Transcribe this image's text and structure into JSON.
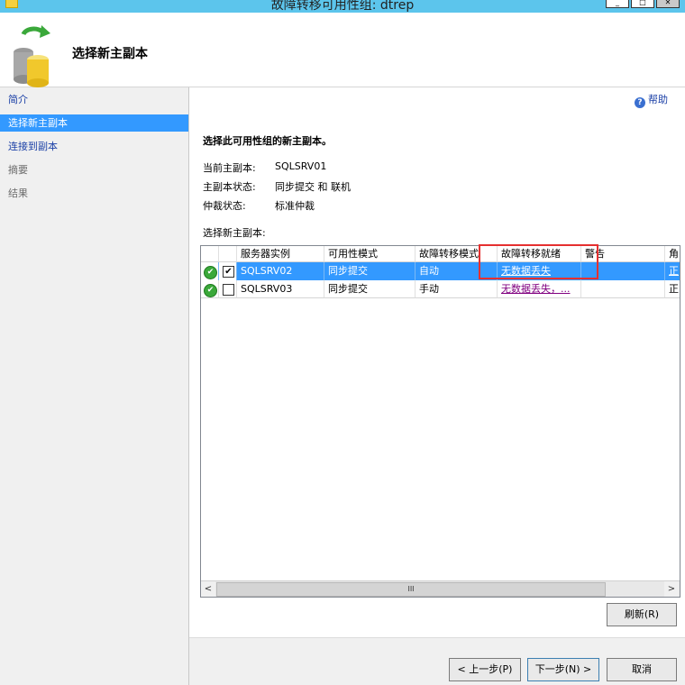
{
  "window": {
    "title": "故障转移可用性组: dtrep"
  },
  "header": {
    "heading": "选择新主副本",
    "icon": "database-failover-icon"
  },
  "sidebar": {
    "items": [
      {
        "label": "简介",
        "state": "link"
      },
      {
        "label": "选择新主副本",
        "state": "active"
      },
      {
        "label": "连接到副本",
        "state": "link"
      },
      {
        "label": "摘要",
        "state": "disabled"
      },
      {
        "label": "结果",
        "state": "disabled"
      }
    ]
  },
  "main": {
    "help": "帮助",
    "instruction": "选择此可用性组的新主副本。",
    "info": [
      {
        "label": "当前主副本:",
        "value": "SQLSRV01"
      },
      {
        "label": "主副本状态:",
        "value": "同步提交 和 联机"
      },
      {
        "label": "仲裁状态:",
        "value": "标准仲裁"
      }
    ],
    "grid_label": "选择新主副本:",
    "grid": {
      "columns": [
        "服务器实例",
        "可用性模式",
        "故障转移模式",
        "故障转移就绪",
        "警告",
        "角"
      ],
      "rows": [
        {
          "selected": true,
          "checked": true,
          "check_glyph": "✔",
          "status_glyph": "✔",
          "instance": "SQLSRV02",
          "availability": "同步提交",
          "failover_mode": "自动",
          "readiness": "无数据丢失",
          "warning": "",
          "role": "正"
        },
        {
          "selected": false,
          "checked": false,
          "check_glyph": "",
          "status_glyph": "✔",
          "instance": "SQLSRV03",
          "availability": "同步提交",
          "failover_mode": "手动",
          "readiness": "无数据丢失，...",
          "warning": "",
          "role": "正"
        }
      ],
      "scroll": {
        "left": "<",
        "right": ">",
        "thumb": "III"
      }
    },
    "refresh_button": "刷新(R)"
  },
  "footer": {
    "prev_button": "< 上一步(P)",
    "next_button": "下一步(N) >",
    "cancel_button": "取消"
  },
  "window_buttons": {
    "min": "_",
    "max": "□",
    "close": "✕"
  },
  "colors": {
    "selection": "#3399ff",
    "titlebar": "#5cc5ec",
    "link": "#1a3fa6",
    "annotation": "#e53030"
  }
}
